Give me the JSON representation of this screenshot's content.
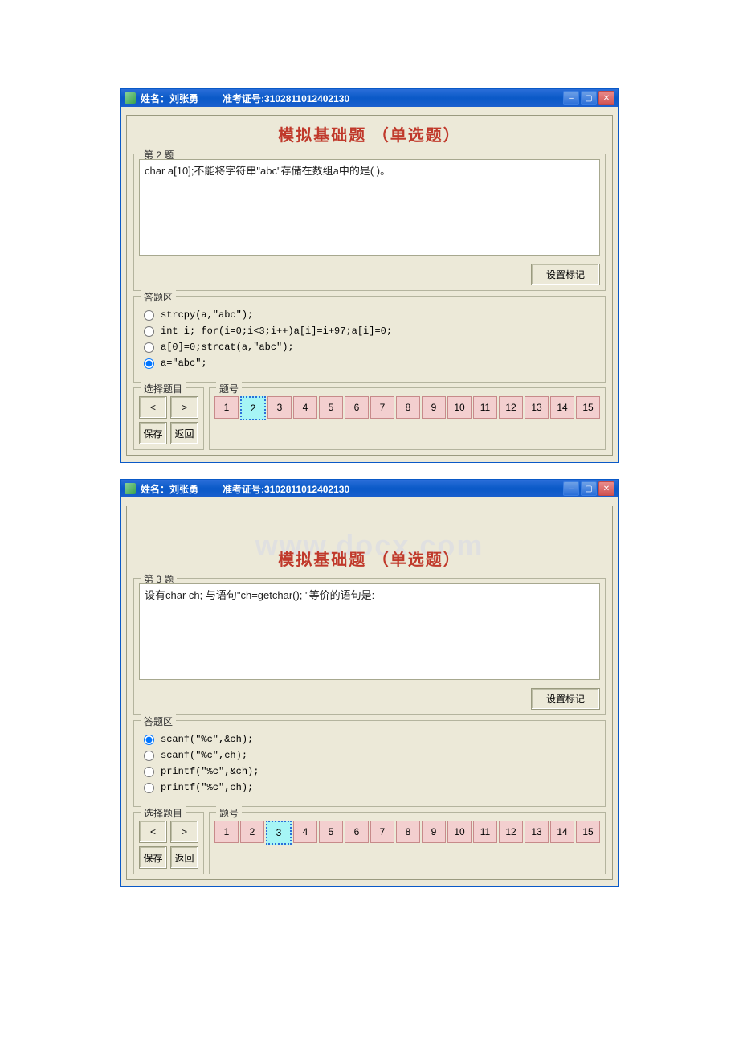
{
  "watermark": "www.docx.com",
  "windows": [
    {
      "title_name": "姓名：刘张勇",
      "title_id": "准考证号:3102811012402130",
      "heading": "模拟基础题 （单选题）",
      "qnum_label": "第 2 题",
      "question": "char a[10];不能将字符串\"abc\"存储在数组a中的是( )。",
      "mark_btn": "设置标记",
      "answer_label": "答题区",
      "options": [
        {
          "text": "strcpy(a,\"abc\");",
          "sel": false
        },
        {
          "text": "int i; for(i=0;i<3;i++)a[i]=i+97;a[i]=0;",
          "sel": false
        },
        {
          "text": "a[0]=0;strcat(a,\"abc\");",
          "sel": false
        },
        {
          "text": "a=\"abc\";",
          "sel": true
        }
      ],
      "nav_label": "选择题目",
      "num_label": "题号",
      "prev": "<",
      "next": ">",
      "save": "保存",
      "back": "返回",
      "current": 2,
      "numbers": [
        "1",
        "2",
        "3",
        "4",
        "5",
        "6",
        "7",
        "8",
        "9",
        "10",
        "11",
        "12",
        "13",
        "14",
        "15"
      ]
    },
    {
      "title_name": "姓名：刘张勇",
      "title_id": "准考证号:3102811012402130",
      "heading": "模拟基础题 （单选题）",
      "qnum_label": "第 3 题",
      "question": "设有char ch; 与语句\"ch=getchar(); \"等价的语句是:",
      "mark_btn": "设置标记",
      "answer_label": "答题区",
      "options": [
        {
          "text": "scanf(\"%c\",&ch);",
          "sel": true
        },
        {
          "text": "scanf(\"%c\",ch);",
          "sel": false
        },
        {
          "text": "printf(\"%c\",&ch);",
          "sel": false
        },
        {
          "text": "printf(\"%c\",ch);",
          "sel": false
        }
      ],
      "nav_label": "选择题目",
      "num_label": "题号",
      "prev": "<",
      "next": ">",
      "save": "保存",
      "back": "返回",
      "current": 3,
      "numbers": [
        "1",
        "2",
        "3",
        "4",
        "5",
        "6",
        "7",
        "8",
        "9",
        "10",
        "11",
        "12",
        "13",
        "14",
        "15"
      ]
    }
  ]
}
